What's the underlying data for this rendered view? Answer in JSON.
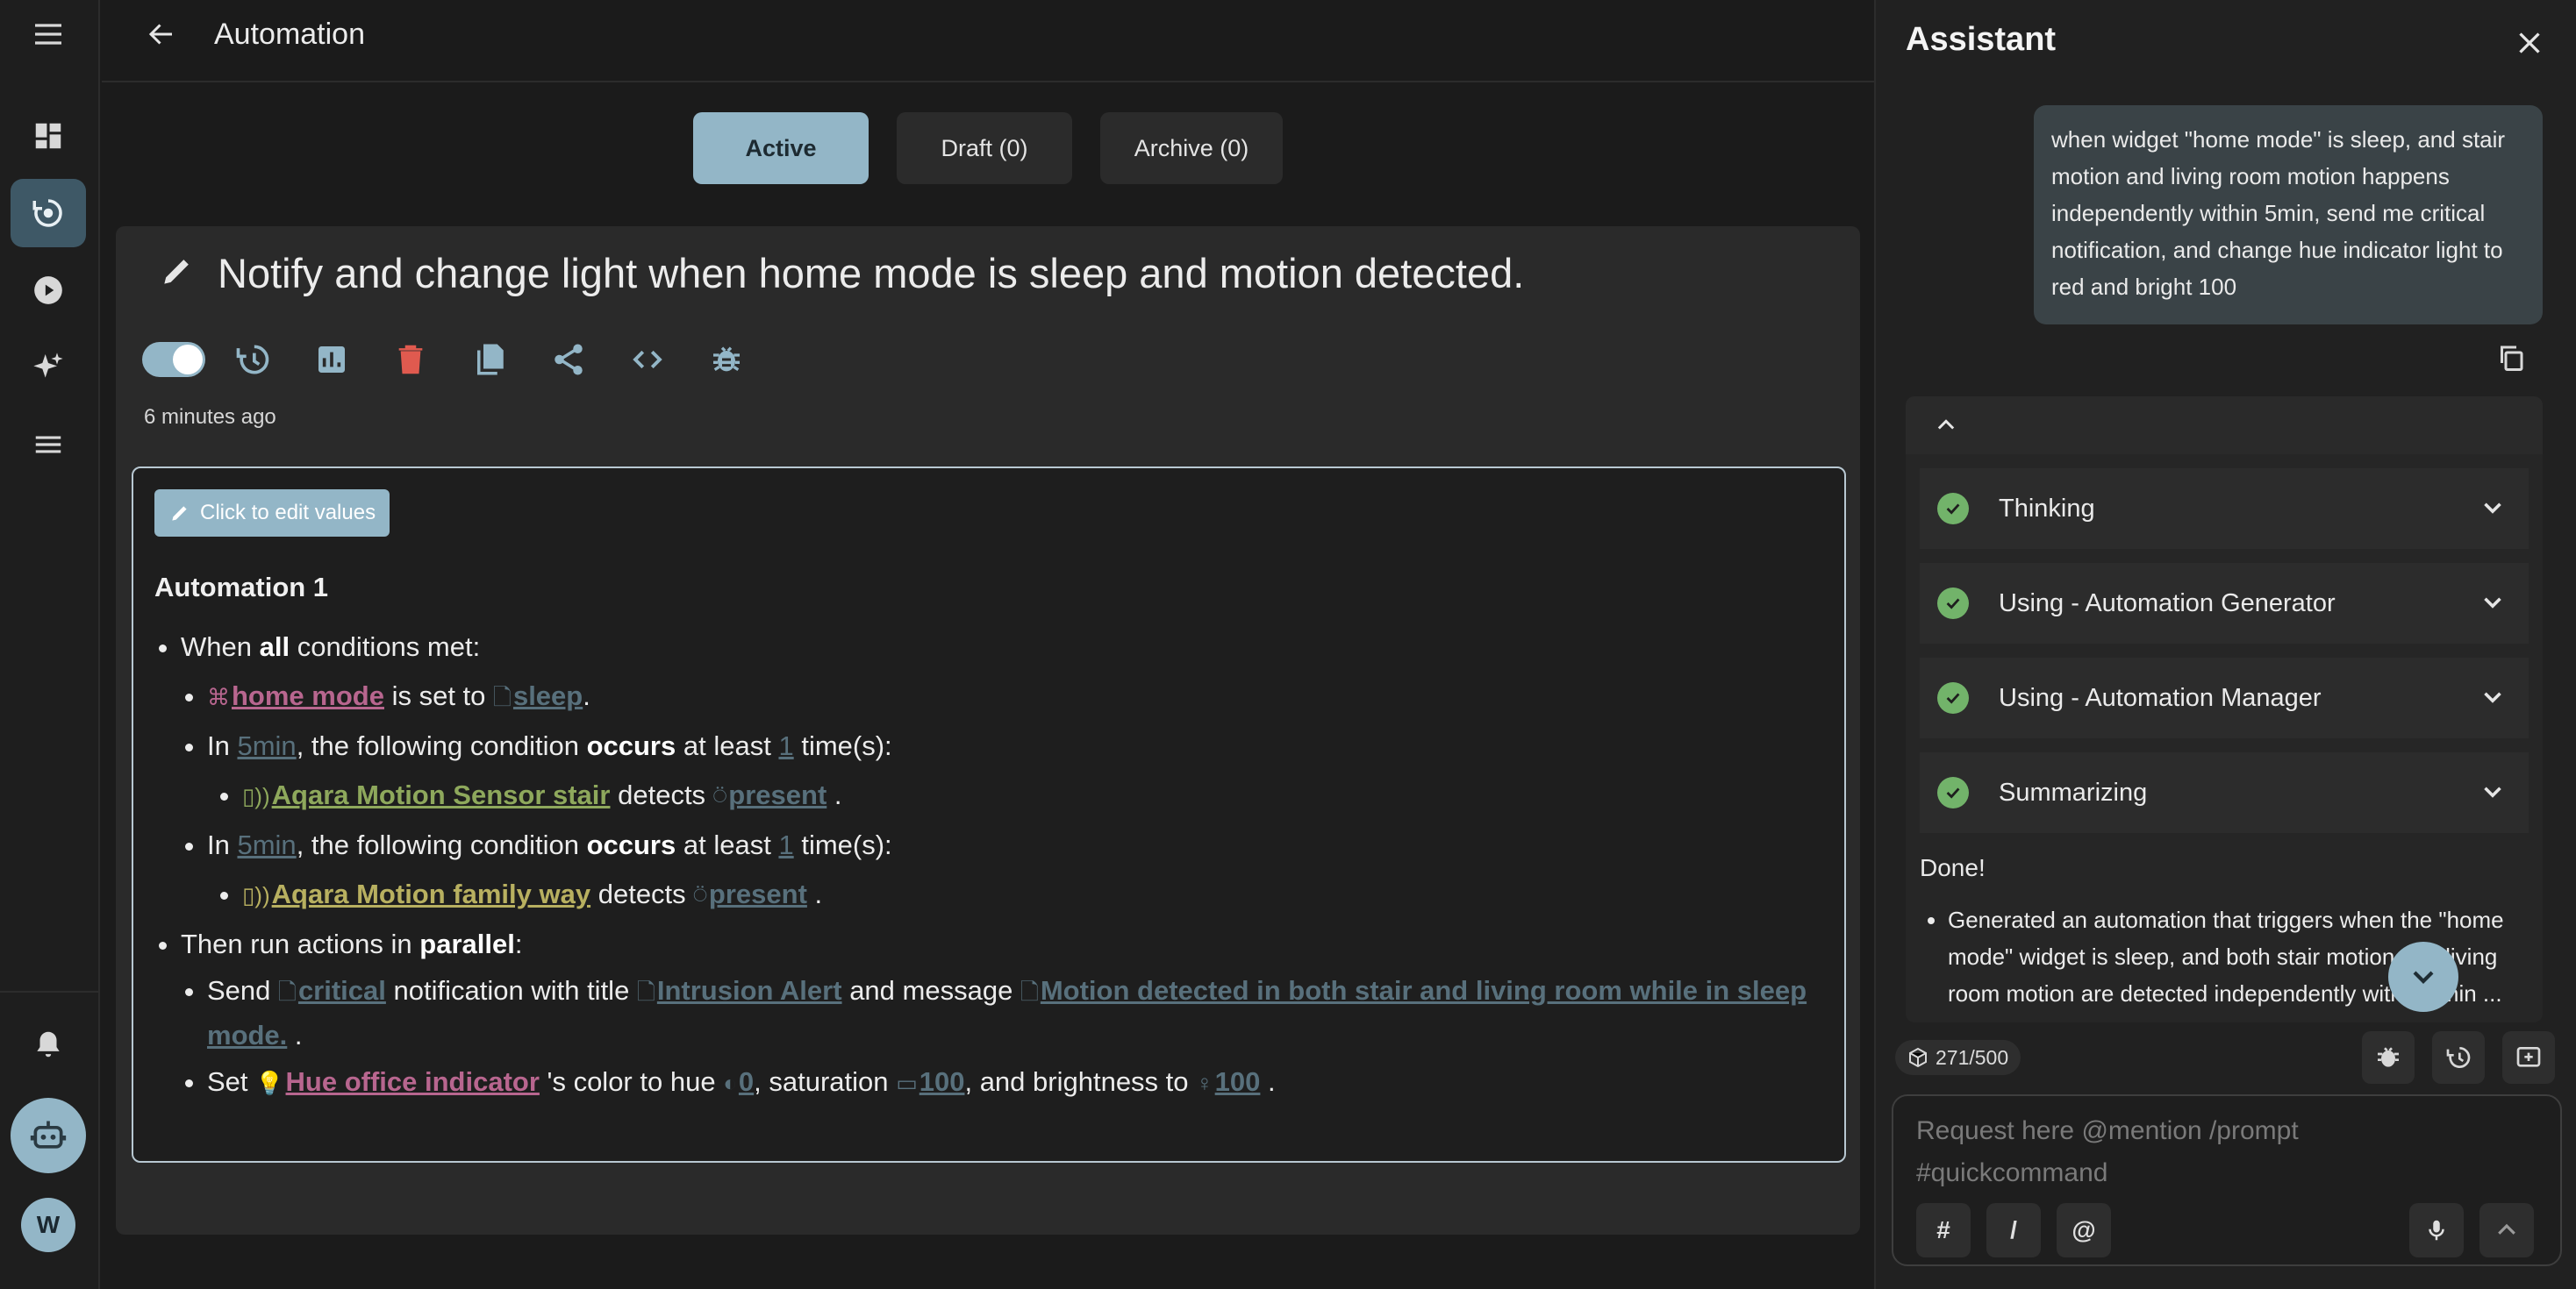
{
  "header": {
    "title": "Automation"
  },
  "tabs": [
    {
      "label": "Active"
    },
    {
      "label": "Draft (0)"
    },
    {
      "label": "Archive (0)"
    }
  ],
  "automation": {
    "title": "Notify and change light when home mode is sleep and motion detected.",
    "enabled": true,
    "timestamp": "6 minutes ago",
    "edit_label": "Click to edit values",
    "name": "Automation 1",
    "when": {
      "prefix": "When",
      "bold": "all",
      "suffix": "conditions met:"
    },
    "cond_widget": {
      "name": "home mode",
      "mid": "is set to",
      "value": "sleep",
      "end": "."
    },
    "occur1": {
      "in": "In",
      "window": "5min",
      "text1": ", the following condition",
      "bold": "occurs",
      "text2": "at least",
      "count": "1",
      "text3": "time(s):"
    },
    "sensor1": {
      "device": "Aqara Motion Sensor stair",
      "verb": "detects",
      "value": "present",
      "end": "."
    },
    "occur2": {
      "in": "In",
      "window": "5min",
      "text1": ", the following condition",
      "bold": "occurs",
      "text2": "at least",
      "count": "1",
      "text3": "time(s):"
    },
    "sensor2": {
      "device": "Aqara Motion family way",
      "verb": "detects",
      "value": "present",
      "end": "."
    },
    "then": {
      "prefix": "Then run actions in",
      "bold": "parallel",
      "suffix": ":"
    },
    "action_notify": {
      "send": "Send",
      "level": "critical",
      "mid1": "notification with title",
      "title": "Intrusion Alert",
      "mid2": "and message",
      "message": "Motion detected in both stair and living room while in sleep mode.",
      "end": "."
    },
    "action_light": {
      "set": "Set",
      "device": "Hue office indicator",
      "mid1": "'s color to hue",
      "hue": "0",
      "mid2": ", saturation",
      "saturation": "100",
      "mid3": ", and brightness to",
      "brightness": "100",
      "end": "."
    }
  },
  "assistant": {
    "title": "Assistant",
    "user_message": "when widget \"home mode\" is sleep, and stair motion and living room motion happens independently within 5min, send me critical notification, and change hue indicator light to red and bright 100",
    "steps": [
      {
        "label": "Thinking"
      },
      {
        "label": "Using - Automation Generator"
      },
      {
        "label": "Using - Automation Manager"
      },
      {
        "label": "Summarizing"
      }
    ],
    "done": "Done!",
    "result": "Generated an automation that triggers when the \"home mode\" widget is sleep, and both stair motion and living room motion are detected independently within 5min ...",
    "quota": "271/500",
    "input_placeholder": "Request here @mention /prompt #quickcommand",
    "input_buttons": [
      "#",
      "/",
      "@"
    ]
  },
  "sidebar": {
    "icons": [
      "menu-icon",
      "dashboard-icon",
      "automation-icon",
      "play-icon",
      "sparkle-icon",
      "list-icon",
      "bell-icon",
      "robot-icon"
    ],
    "avatar_initial": "W"
  },
  "colors": {
    "accent": "#93b6c7",
    "success": "#72b36a",
    "danger": "#e05a4f",
    "widget": "#b8668f",
    "device": "#8ea85c"
  }
}
